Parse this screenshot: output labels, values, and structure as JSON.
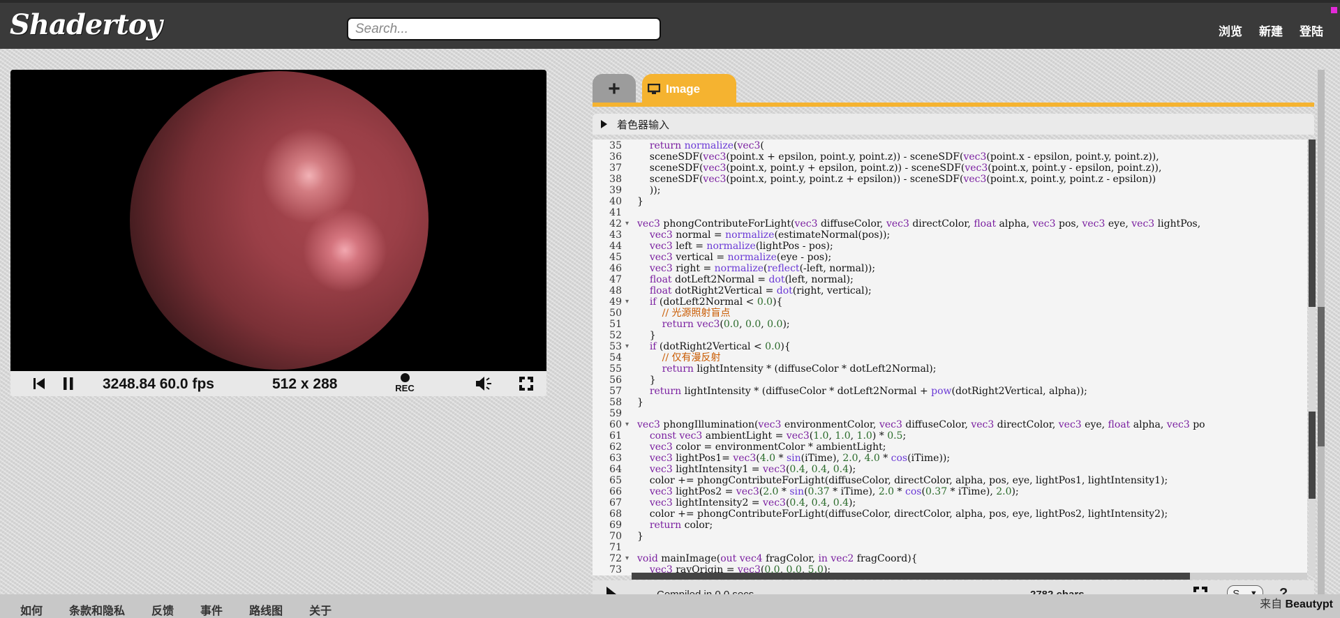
{
  "header": {
    "logo": "Shadertoy",
    "search_placeholder": "Search...",
    "nav": [
      "浏览",
      "新建",
      "登陆"
    ]
  },
  "player": {
    "time_fps": "3248.84 60.0 fps",
    "resolution": "512 x 288",
    "rec_label": "REC",
    "icons": [
      "rewind-icon",
      "pause-icon",
      "record-icon",
      "volume-icon",
      "fullscreen-icon"
    ]
  },
  "editor": {
    "tabs": {
      "add": "+",
      "image": "Image"
    },
    "shader_inputs": "着色器输入",
    "code_lines": [
      {
        "n": "35",
        "fold": "",
        "t": "    return normalize(vec3("
      },
      {
        "n": "36",
        "fold": "",
        "t": "    sceneSDF(vec3(point.x + epsilon, point.y, point.z)) - sceneSDF(vec3(point.x - epsilon, point.y, point.z)),"
      },
      {
        "n": "37",
        "fold": "",
        "t": "    sceneSDF(vec3(point.x, point.y + epsilon, point.z)) - sceneSDF(vec3(point.x, point.y - epsilon, point.z)),"
      },
      {
        "n": "38",
        "fold": "",
        "t": "    sceneSDF(vec3(point.x, point.y, point.z + epsilon)) - sceneSDF(vec3(point.x, point.y, point.z - epsilon))"
      },
      {
        "n": "39",
        "fold": "",
        "t": "    ));"
      },
      {
        "n": "40",
        "fold": "",
        "t": "}"
      },
      {
        "n": "41",
        "fold": "",
        "t": ""
      },
      {
        "n": "42",
        "fold": "▾",
        "t": "vec3 phongContributeForLight(vec3 diffuseColor, vec3 directColor, float alpha, vec3 pos, vec3 eye, vec3 lightPos,"
      },
      {
        "n": "43",
        "fold": "",
        "t": "    vec3 normal = normalize(estimateNormal(pos));"
      },
      {
        "n": "44",
        "fold": "",
        "t": "    vec3 left = normalize(lightPos - pos);"
      },
      {
        "n": "45",
        "fold": "",
        "t": "    vec3 vertical = normalize(eye - pos);"
      },
      {
        "n": "46",
        "fold": "",
        "t": "    vec3 right = normalize(reflect(-left, normal));"
      },
      {
        "n": "47",
        "fold": "",
        "t": "    float dotLeft2Normal = dot(left, normal);"
      },
      {
        "n": "48",
        "fold": "",
        "t": "    float dotRight2Vertical = dot(right, vertical);"
      },
      {
        "n": "49",
        "fold": "▾",
        "t": "    if (dotLeft2Normal < 0.0){"
      },
      {
        "n": "50",
        "fold": "",
        "t": "        // 光源照射盲点"
      },
      {
        "n": "51",
        "fold": "",
        "t": "        return vec3(0.0, 0.0, 0.0);"
      },
      {
        "n": "52",
        "fold": "",
        "t": "    }"
      },
      {
        "n": "53",
        "fold": "▾",
        "t": "    if (dotRight2Vertical < 0.0){"
      },
      {
        "n": "54",
        "fold": "",
        "t": "        // 仅有漫反射"
      },
      {
        "n": "55",
        "fold": "",
        "t": "        return lightIntensity * (diffuseColor * dotLeft2Normal);"
      },
      {
        "n": "56",
        "fold": "",
        "t": "    }"
      },
      {
        "n": "57",
        "fold": "",
        "t": "    return lightIntensity * (diffuseColor * dotLeft2Normal + pow(dotRight2Vertical, alpha));"
      },
      {
        "n": "58",
        "fold": "",
        "t": "}"
      },
      {
        "n": "59",
        "fold": "",
        "t": ""
      },
      {
        "n": "60",
        "fold": "▾",
        "t": "vec3 phongIllumination(vec3 environmentColor, vec3 diffuseColor, vec3 directColor, vec3 eye, float alpha, vec3 po"
      },
      {
        "n": "61",
        "fold": "",
        "t": "    const vec3 ambientLight = vec3(1.0, 1.0, 1.0) * 0.5;"
      },
      {
        "n": "62",
        "fold": "",
        "t": "    vec3 color = environmentColor * ambientLight;"
      },
      {
        "n": "63",
        "fold": "",
        "t": "    vec3 lightPos1= vec3(4.0 * sin(iTime), 2.0, 4.0 * cos(iTime));"
      },
      {
        "n": "64",
        "fold": "",
        "t": "    vec3 lightIntensity1 = vec3(0.4, 0.4, 0.4);"
      },
      {
        "n": "65",
        "fold": "",
        "t": "    color += phongContributeForLight(diffuseColor, directColor, alpha, pos, eye, lightPos1, lightIntensity1);"
      },
      {
        "n": "66",
        "fold": "",
        "t": "    vec3 lightPos2 = vec3(2.0 * sin(0.37 * iTime), 2.0 * cos(0.37 * iTime), 2.0);"
      },
      {
        "n": "67",
        "fold": "",
        "t": "    vec3 lightIntensity2 = vec3(0.4, 0.4, 0.4);"
      },
      {
        "n": "68",
        "fold": "",
        "t": "    color += phongContributeForLight(diffuseColor, directColor, alpha, pos, eye, lightPos2, lightIntensity2);"
      },
      {
        "n": "69",
        "fold": "",
        "t": "    return color;"
      },
      {
        "n": "70",
        "fold": "",
        "t": "}"
      },
      {
        "n": "71",
        "fold": "",
        "t": ""
      },
      {
        "n": "72",
        "fold": "▾",
        "t": "void mainImage(out vec4 fragColor, in vec2 fragCoord){"
      },
      {
        "n": "73",
        "fold": "",
        "t": "    vec3 rayOrigin = vec3(0.0, 0.0, 5.0);"
      }
    ],
    "status": {
      "compiled": "Compiled in 0.0 secs",
      "chars": "2782 chars",
      "font_select": "S",
      "help": "?"
    }
  },
  "footer": {
    "links": [
      "如何",
      "条款和隐私",
      "反馈",
      "事件",
      "路线图",
      "关于"
    ],
    "from_prefix": "来自",
    "from_author": "Beautypt"
  },
  "colors": {
    "header_bg": "#3a3a3a",
    "tab_accent": "#f5b330",
    "sphere": "#9a3f47"
  }
}
